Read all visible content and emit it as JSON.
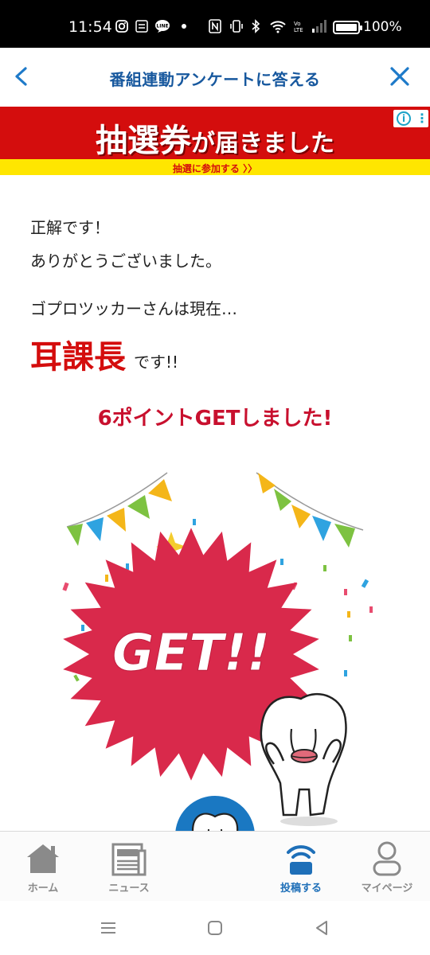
{
  "status_bar": {
    "time": "11:54",
    "battery_pct": "100%",
    "battery_level": 1.0,
    "icons": [
      "instagram-icon",
      "app-icon",
      "line-icon",
      "dot-icon",
      "nfc-icon",
      "vibrate-icon",
      "bluetooth-icon",
      "wifi-icon",
      "volte-icon",
      "signal-icon",
      "battery-icon"
    ]
  },
  "header": {
    "title": "番組連動アンケートに答える",
    "back_icon": "chevron-left-icon",
    "close_icon": "close-icon"
  },
  "banner": {
    "headline_big": "抽選券",
    "headline_small": "が届きました",
    "subline": "抽選に参加する 〉〉",
    "ad_icons": [
      "info-icon",
      "more-icon"
    ]
  },
  "result": {
    "line1": "正解です！",
    "line2": "ありがとうございました。",
    "line3": "ゴプロツッカーさんは現在…",
    "rank": "耳課長",
    "rank_suffix": "です!!",
    "points_message": "6ポイントGETしました!"
  },
  "illustration": {
    "burst_text": "GET!!"
  },
  "tab_bar": {
    "items": [
      {
        "label": "ホーム",
        "icon": "home-icon",
        "active": false
      },
      {
        "label": "ニュース",
        "icon": "news-icon",
        "active": false
      },
      {
        "label": "",
        "icon": "mascot-icon",
        "active": false
      },
      {
        "label": "投稿する",
        "icon": "post-icon",
        "active": true
      },
      {
        "label": "マイページ",
        "icon": "person-icon",
        "active": false
      }
    ]
  },
  "colors": {
    "accent_blue": "#1e7ac9",
    "title_blue": "#17589e",
    "banner_red": "#d40d0d",
    "banner_yellow": "#ffe600",
    "burst_red": "#d9294b",
    "active_tab_blue": "#1e6fb8"
  }
}
